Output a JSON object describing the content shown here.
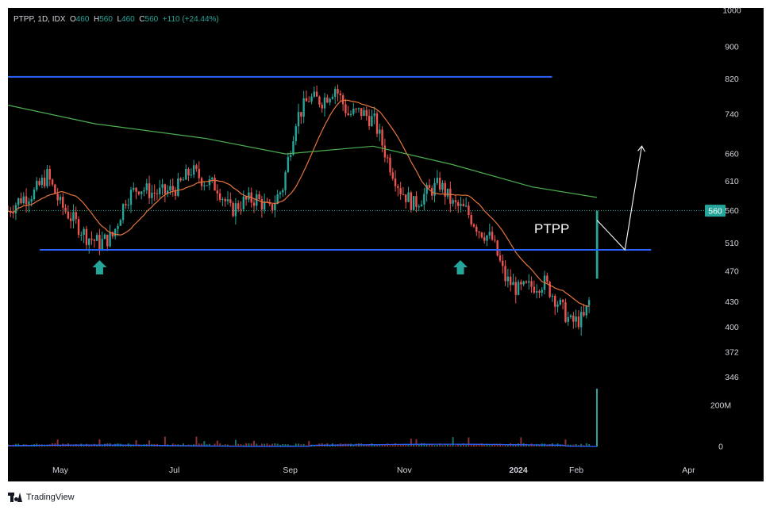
{
  "header": {
    "symbol": "PTPP, 1D, IDX",
    "open_label": "O",
    "open": "460",
    "high_label": "H",
    "high": "560",
    "low_label": "L",
    "low": "460",
    "close_label": "C",
    "close": "560",
    "change": "+110 (+24.44%)"
  },
  "footer": {
    "brand": "TradingView",
    "logo_icon": "tradingview-logo-icon"
  },
  "colors": {
    "background": "#000000",
    "up": "#26a69a",
    "down": "#ef5350",
    "ma_fast": "#e8743b",
    "ma_slow": "#4caf50",
    "levels": "#2962ff",
    "volume_ma": "#2962ff",
    "price_label": "#26a69a"
  },
  "chart_data": {
    "type": "candlestick",
    "scale": "log",
    "price_axis_ticks": [
      "1000",
      "900",
      "820",
      "740",
      "660",
      "610",
      "560",
      "510",
      "470",
      "430",
      "400",
      "372",
      "346"
    ],
    "volume_axis_ticks": [
      "200M",
      "0"
    ],
    "time_axis_ticks": [
      "May",
      "Jul",
      "Sep",
      "Nov",
      "2024",
      "Feb",
      "Apr"
    ],
    "current_price_label": "560",
    "annotation_text": "PTPP",
    "horizontal_levels": [
      {
        "value": 825,
        "from": "2023-04-03",
        "to": "2024-01-19"
      },
      {
        "value": 500,
        "from": "2023-04-20",
        "to": "2024-03-12"
      }
    ],
    "arrows_up": [
      {
        "date": "2023-05-22",
        "below_price": 500
      },
      {
        "date": "2023-12-01",
        "below_price": 500
      }
    ],
    "projection_path": [
      {
        "date": "2024-02-12",
        "price": 545
      },
      {
        "date": "2024-02-27",
        "price": 500
      },
      {
        "date": "2024-03-07",
        "price": 675
      }
    ],
    "price_path": [
      [
        "2023-04-03",
        560
      ],
      [
        "2023-04-10",
        580
      ],
      [
        "2023-04-17",
        590
      ],
      [
        "2023-04-24",
        620
      ],
      [
        "2023-05-01",
        570
      ],
      [
        "2023-05-08",
        545
      ],
      [
        "2023-05-15",
        520
      ],
      [
        "2023-05-22",
        510
      ],
      [
        "2023-05-29",
        520
      ],
      [
        "2023-06-05",
        580
      ],
      [
        "2023-06-12",
        600
      ],
      [
        "2023-06-19",
        590
      ],
      [
        "2023-06-26",
        590
      ],
      [
        "2023-07-03",
        600
      ],
      [
        "2023-07-10",
        630
      ],
      [
        "2023-07-17",
        610
      ],
      [
        "2023-07-24",
        600
      ],
      [
        "2023-07-31",
        560
      ],
      [
        "2023-08-07",
        575
      ],
      [
        "2023-08-14",
        580
      ],
      [
        "2023-08-21",
        560
      ],
      [
        "2023-08-28",
        600
      ],
      [
        "2023-09-04",
        730
      ],
      [
        "2023-09-11",
        775
      ],
      [
        "2023-09-18",
        770
      ],
      [
        "2023-09-25",
        800
      ],
      [
        "2023-10-02",
        740
      ],
      [
        "2023-10-09",
        745
      ],
      [
        "2023-10-16",
        725
      ],
      [
        "2023-10-23",
        650
      ],
      [
        "2023-10-30",
        595
      ],
      [
        "2023-11-06",
        570
      ],
      [
        "2023-11-13",
        590
      ],
      [
        "2023-11-20",
        605
      ],
      [
        "2023-11-27",
        570
      ],
      [
        "2023-12-04",
        560
      ],
      [
        "2023-12-11",
        530
      ],
      [
        "2023-12-18",
        515
      ],
      [
        "2023-12-25",
        460
      ],
      [
        "2024-01-01",
        445
      ],
      [
        "2024-01-08",
        450
      ],
      [
        "2024-01-15",
        455
      ],
      [
        "2024-01-22",
        430
      ],
      [
        "2024-01-29",
        405
      ],
      [
        "2024-02-05",
        410
      ],
      [
        "2024-02-09",
        440
      ]
    ],
    "last_candle": {
      "date": "2024-02-12",
      "open": 460,
      "high": 560,
      "low": 460,
      "close": 560
    },
    "volume_spike": {
      "date": "2024-02-12",
      "value": 280
    }
  }
}
